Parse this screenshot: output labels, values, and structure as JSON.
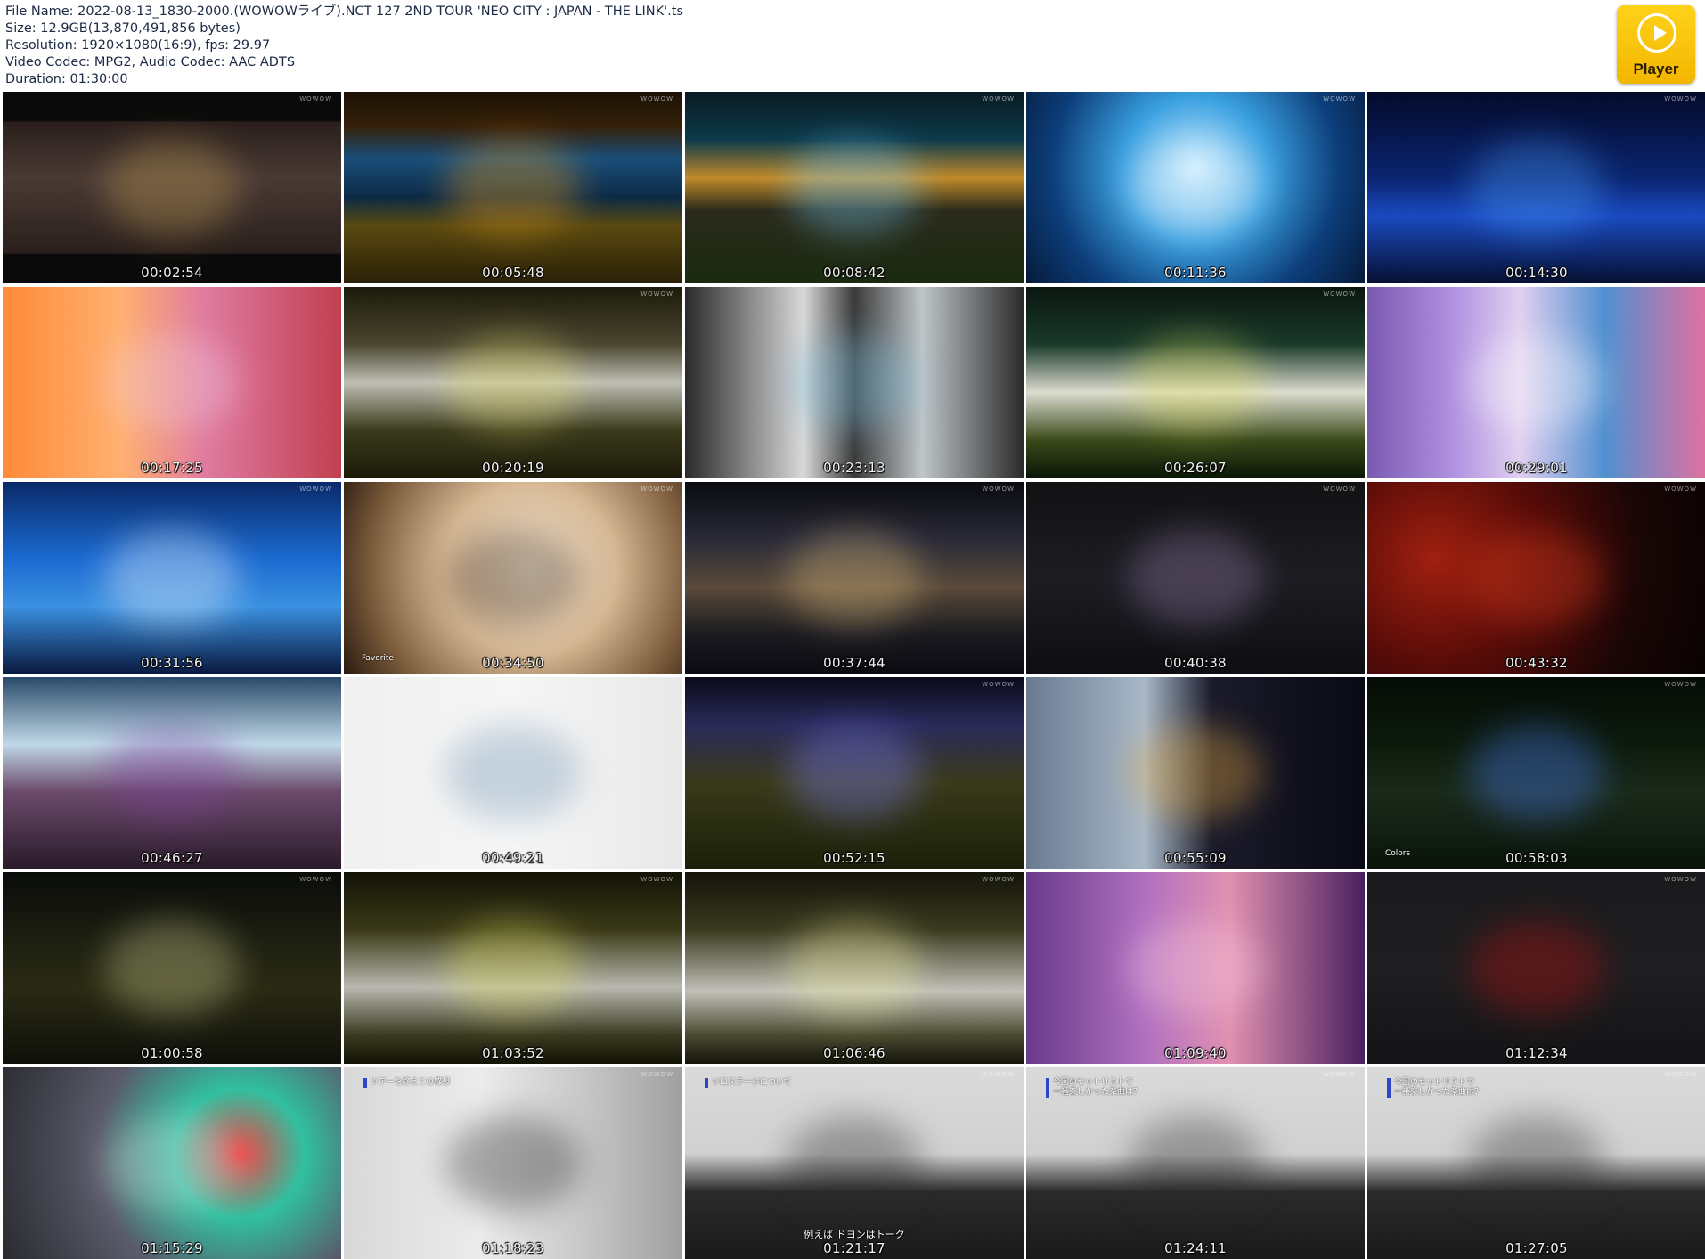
{
  "header": {
    "file_name_label": "File Name:",
    "file_name": "2022-08-13_1830-2000.(WOWOWライブ).NCT 127 2ND TOUR 'NEO CITY : JAPAN - THE LINK'.ts",
    "size_label": "Size:",
    "size": "12.9GB(13,870,491,856 bytes)",
    "resolution_label": "Resolution:",
    "resolution": "1920×1080(16:9), fps: 29.97",
    "codec_label": "Video Codec:",
    "codec": "MPG2, Audio Codec: AAC ADTS",
    "duration_label": "Duration:",
    "duration": "01:30:00"
  },
  "player_button": {
    "label": "Player",
    "icon": "play-circle-icon",
    "color": "#f5c000"
  },
  "thumbnails": [
    {
      "time": "00:02:54",
      "bg": "linear-gradient(180deg,#0a0a0a 0%,#0a0a0a 15%,#2a1f1c 16%,#4a3a34 45%,#2a1f1c 84%,#0a0a0a 85%)",
      "accent": "#c9a55a",
      "watermark": "WOWOW"
    },
    {
      "time": "00:05:48",
      "bg": "linear-gradient(180deg,#1c1206 0%,#352009 18%,#1a4e7a 35%,#0c2a45 55%,#5a4a10 70%,#2a2006 100%)",
      "accent": "#f0a020",
      "watermark": "WOWOW"
    },
    {
      "time": "00:08:42",
      "bg": "linear-gradient(180deg,#091a22 0%,#0c3a4a 25%,#c08a2a 45%,#2a2a1a 62%,#1a2a10 100%)",
      "accent": "#7ad0ff",
      "watermark": "WOWOW"
    },
    {
      "time": "00:11:36",
      "bg": "radial-gradient(circle at 50% 40%,#bfe8ff 0%,#3aa0e0 35%,#0c3e7a 70%,#061a3a 100%)",
      "accent": "#ffffff",
      "watermark": "WOWOW"
    },
    {
      "time": "00:14:30",
      "bg": "linear-gradient(180deg,#040a2a 0%,#0a2470 45%,#1a4ac0 65%,#061030 100%)",
      "accent": "#4aa0ff",
      "watermark": "WOWOW"
    },
    {
      "time": "00:17:25",
      "bg": "linear-gradient(90deg,#ff8a3a 0%,#ffb070 35%,#e07aa0 60%,#c04050 100%)",
      "accent": "#f0d0e0",
      "watermark": ""
    },
    {
      "time": "00:20:19",
      "bg": "linear-gradient(180deg,#1c1a0a 0%,#4a4630 30%,#bfbfb5 50%,#3a3a1c 75%,#1c1a08 100%)",
      "accent": "#e8e070",
      "watermark": "WOWOW"
    },
    {
      "time": "00:23:13",
      "bg": "linear-gradient(90deg,#2a2a2a 0%,#d8d8d8 35%,#3a3a3a 50%,#bfc5c8 70%,#2a2a2a 100%)",
      "accent": "#7ac0e0",
      "watermark": ""
    },
    {
      "time": "00:26:07",
      "bg": "linear-gradient(180deg,#0a1610 0%,#1a3a2a 30%,#dcdcd0 55%,#3a4a1a 80%,#0a1606 100%)",
      "accent": "#e0e060",
      "watermark": "WOWOW"
    },
    {
      "time": "00:29:01",
      "bg": "linear-gradient(90deg,#7a5ab0 0%,#b090e0 25%,#e0d0f0 45%,#5090d0 70%,#e070a0 100%)",
      "accent": "#ffffff",
      "watermark": ""
    },
    {
      "time": "00:31:56",
      "bg": "linear-gradient(180deg,#0a2a6a 0%,#1a6ad0 40%,#3a90e0 65%,#0a1a40 100%)",
      "accent": "#ffffff",
      "watermark": "WOWOW"
    },
    {
      "time": "00:34:50",
      "bg": "radial-gradient(circle at 55% 45%,#f4e6d2 0%,#d6b894 40%,#7a5a3a 75%,#2a1a10 100%)",
      "accent": "#3a2a20",
      "watermark": "WOWOW",
      "caption": "Favorite"
    },
    {
      "time": "00:37:44",
      "bg": "linear-gradient(180deg,#0a0a10 0%,#2a2a38 30%,#5a4a3a 55%,#1a1a20 80%,#0a0a10 100%)",
      "accent": "#e0c080",
      "watermark": "WOWOW"
    },
    {
      "time": "00:40:38",
      "bg": "linear-gradient(180deg,#121214 0%,#1c1c22 50%,#0e0e12 100%)",
      "accent": "#9a80b0",
      "watermark": "WOWOW"
    },
    {
      "time": "00:43:32",
      "bg": "radial-gradient(circle at 20% 40%,#a02010 0%,#5a0c08 35%,#1a0606 70%,#0a0202 100%)",
      "accent": "#e04020",
      "watermark": "WOWOW"
    },
    {
      "time": "00:46:27",
      "bg": "linear-gradient(180deg,#2a4a6a 0%,#c0d8e8 35%,#6a4a6a 60%,#2a1a2a 100%)",
      "accent": "#8040a0",
      "watermark": ""
    },
    {
      "time": "00:49:21",
      "bg": "linear-gradient(90deg,#f0f0f0 0%,#f6f6f6 50%,#e8e8e8 100%)",
      "accent": "#6a90b0",
      "watermark": ""
    },
    {
      "time": "00:52:15",
      "bg": "linear-gradient(180deg,#0a0a1a 0%,#2a2a5a 25%,#3a3a1a 55%,#1a2008 100%)",
      "accent": "#8080ff",
      "watermark": "WOWOW"
    },
    {
      "time": "00:55:09",
      "bg": "linear-gradient(90deg,#6a7a90 0%,#a8b8c8 35%,#1a1a2a 55%,#0a0a14 100%)",
      "accent": "#f0b040",
      "watermark": ""
    },
    {
      "time": "00:58:03",
      "bg": "linear-gradient(180deg,#060c06 0%,#0c1a0c 35%,#1a2a1a 60%,#0a140a 100%)",
      "accent": "#4a80ff",
      "watermark": "WOWOW",
      "caption": "Colors"
    },
    {
      "time": "01:00:58",
      "bg": "linear-gradient(180deg,#0a0c0a 0%,#1a1c10 30%,#2a2a14 60%,#0e100a 100%)",
      "accent": "#d0d090",
      "watermark": "WOWOW"
    },
    {
      "time": "01:03:52",
      "bg": "linear-gradient(180deg,#121206 0%,#3a3a18 30%,#b8b8b0 60%,#3a3a20 85%,#121206 100%)",
      "accent": "#e0e060",
      "watermark": "WOWOW"
    },
    {
      "time": "01:06:46",
      "bg": "linear-gradient(180deg,#14140a 0%,#3a3a20 30%,#c0c0b8 62%,#4a4a30 85%,#14140a 100%)",
      "accent": "#f0f0a0",
      "watermark": "WOWOW"
    },
    {
      "time": "01:09:40",
      "bg": "linear-gradient(90deg,#6a3a8a 0%,#b070c0 35%,#e090b0 60%,#4a2060 100%)",
      "accent": "#ffd0e0",
      "watermark": ""
    },
    {
      "time": "01:12:34",
      "bg": "linear-gradient(180deg,#1a1a1c 0%,#1e1e20 50%,#141416 100%)",
      "accent": "#c01010",
      "watermark": "WOWOW"
    },
    {
      "time": "01:15:29",
      "bg": "radial-gradient(circle at 70% 45%,#f04040 0%,#30c0a0 25%,#5a5a6a 55%,#2a2a30 100%)",
      "accent": "#e0e0e0",
      "watermark": ""
    },
    {
      "time": "01:18:23",
      "bg": "linear-gradient(90deg,#d8d8d8 0%,#ececec 40%,#c8c8c8 70%,#a0a0a0 100%)",
      "accent": "#202020",
      "watermark": "WOWOW",
      "topcaption": "ツアーを終えての感想"
    },
    {
      "time": "01:21:17",
      "bg": "linear-gradient(180deg,#dadada 0%,#d0d0d0 45%,#2a2a2a 65%,#1a1a1a 100%)",
      "accent": "#2a2a2a",
      "watermark": "WOWOW",
      "topcaption": "ソロステージについて",
      "subtitle": "例えば ドヨンはトーク"
    },
    {
      "time": "01:24:11",
      "bg": "linear-gradient(180deg,#dadada 0%,#d0d0d0 45%,#2a2a2a 65%,#1a1a1a 100%)",
      "accent": "#2a2a2a",
      "watermark": "WOWOW",
      "topcaption": "今回のセットリストで\n一番楽しかった楽曲は？"
    },
    {
      "time": "01:27:05",
      "bg": "linear-gradient(180deg,#dadada 0%,#d0d0d0 45%,#2a2a2a 65%,#1a1a1a 100%)",
      "accent": "#2a2a2a",
      "watermark": "WOWOW",
      "topcaption": "今回のセットリストで\n一番楽しかった楽曲は？"
    }
  ]
}
